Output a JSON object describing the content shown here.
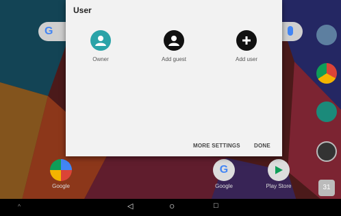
{
  "dialog": {
    "title": "User",
    "users": [
      {
        "label": "Owner",
        "icon": "account-circle-icon"
      },
      {
        "label": "Add guest",
        "icon": "person-icon"
      },
      {
        "label": "Add user",
        "icon": "add-icon"
      }
    ],
    "more_settings": "MORE SETTINGS",
    "done": "DONE"
  },
  "home": {
    "search_icon": "google-g-icon",
    "apps": [
      {
        "label": "Google"
      },
      {
        "label": "Google"
      },
      {
        "label": "Play Store"
      }
    ],
    "dock_icons": [
      "camera-icon",
      "chrome-icon",
      "settings-icon",
      "clock-icon",
      "calendar-icon"
    ],
    "calendar_day": "31"
  },
  "navbar": {
    "back": "◁",
    "home": "○",
    "recents": "□"
  },
  "colors": {
    "owner_accent": "#2aa3a8"
  }
}
